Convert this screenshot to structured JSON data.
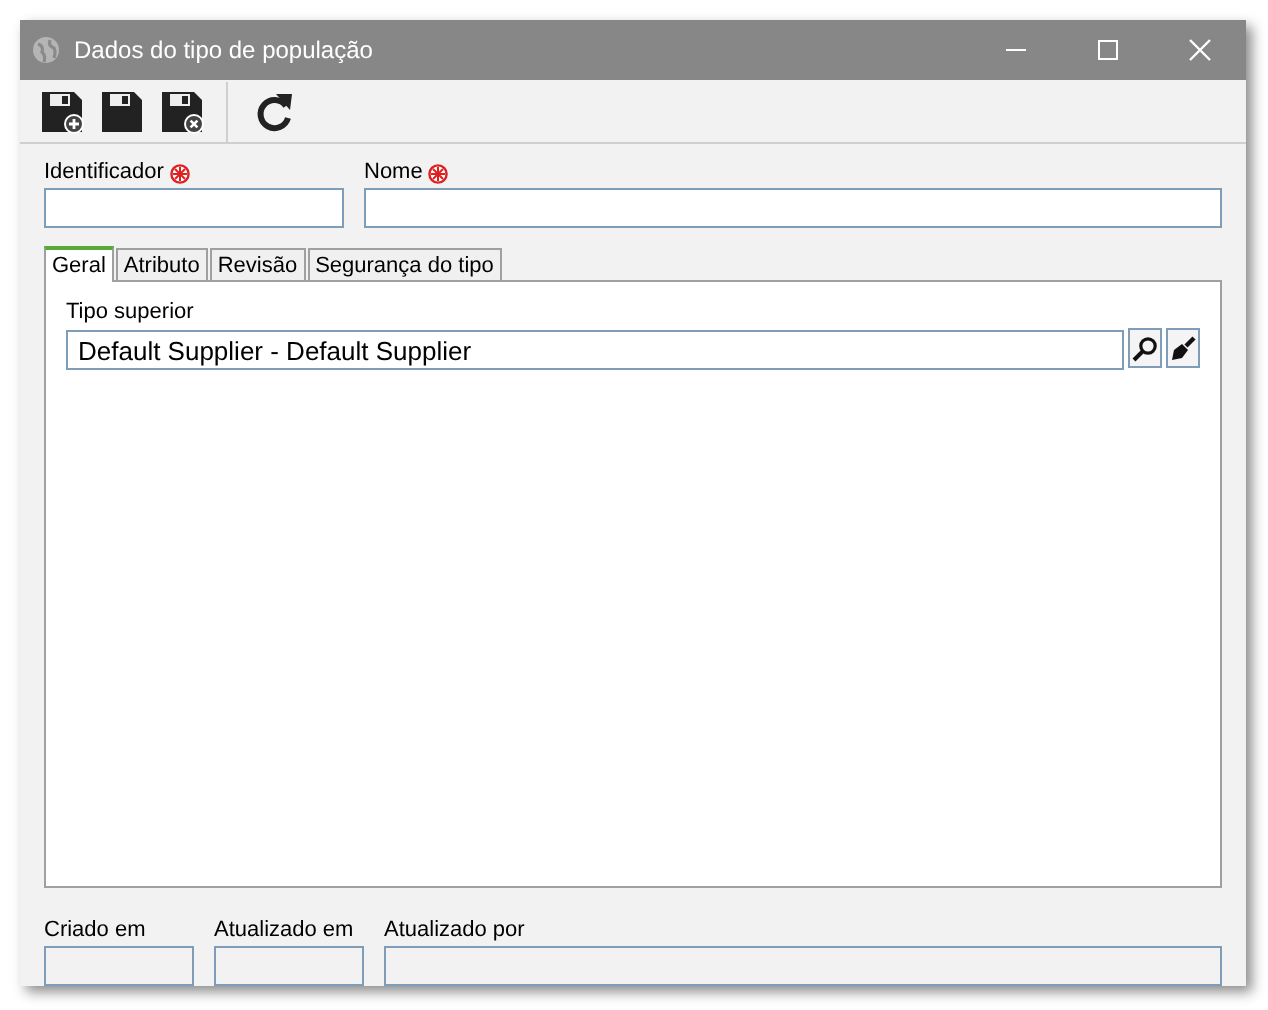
{
  "window": {
    "title": "Dados do tipo de população"
  },
  "fields": [
    {
      "label": "Identificador",
      "required": true
    },
    {
      "label": "Nome",
      "required": true
    }
  ],
  "tabs": [
    {
      "label": "Geral",
      "selected": true
    },
    {
      "label": "Atributo",
      "selected": false
    },
    {
      "label": "Revisão",
      "selected": false
    },
    {
      "label": "Segurança do tipo",
      "selected": false
    }
  ],
  "tipo_superior": {
    "label": "Tipo superior",
    "value": "Default Supplier - Default Supplier"
  },
  "footer": [
    {
      "label": "Criado em"
    },
    {
      "label": "Atualizado em"
    },
    {
      "label": "Atualizado por"
    }
  ]
}
